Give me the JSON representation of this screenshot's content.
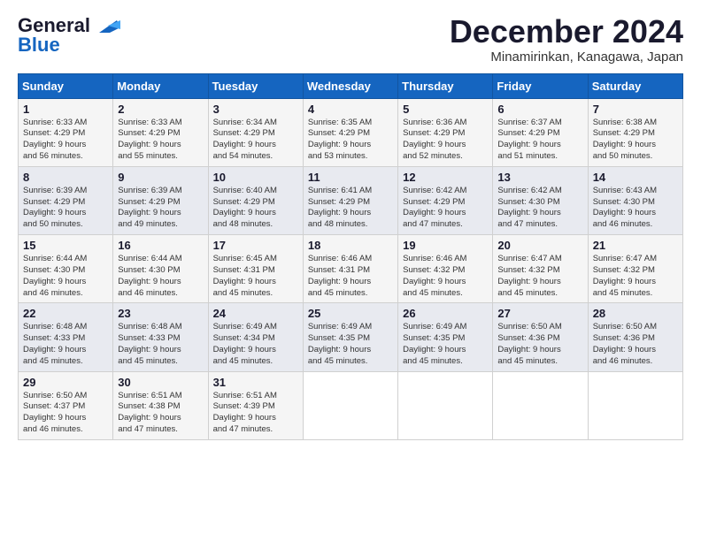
{
  "logo": {
    "line1": "General",
    "line2": "Blue"
  },
  "title": "December 2024",
  "subtitle": "Minamirinkan, Kanagawa, Japan",
  "days_of_week": [
    "Sunday",
    "Monday",
    "Tuesday",
    "Wednesday",
    "Thursday",
    "Friday",
    "Saturday"
  ],
  "weeks": [
    [
      {
        "day": "1",
        "sunrise": "6:33 AM",
        "sunset": "4:29 PM",
        "daylight": "9 hours and 56 minutes."
      },
      {
        "day": "2",
        "sunrise": "6:33 AM",
        "sunset": "4:29 PM",
        "daylight": "9 hours and 55 minutes."
      },
      {
        "day": "3",
        "sunrise": "6:34 AM",
        "sunset": "4:29 PM",
        "daylight": "9 hours and 54 minutes."
      },
      {
        "day": "4",
        "sunrise": "6:35 AM",
        "sunset": "4:29 PM",
        "daylight": "9 hours and 53 minutes."
      },
      {
        "day": "5",
        "sunrise": "6:36 AM",
        "sunset": "4:29 PM",
        "daylight": "9 hours and 52 minutes."
      },
      {
        "day": "6",
        "sunrise": "6:37 AM",
        "sunset": "4:29 PM",
        "daylight": "9 hours and 51 minutes."
      },
      {
        "day": "7",
        "sunrise": "6:38 AM",
        "sunset": "4:29 PM",
        "daylight": "9 hours and 50 minutes."
      }
    ],
    [
      {
        "day": "8",
        "sunrise": "6:39 AM",
        "sunset": "4:29 PM",
        "daylight": "9 hours and 50 minutes."
      },
      {
        "day": "9",
        "sunrise": "6:39 AM",
        "sunset": "4:29 PM",
        "daylight": "9 hours and 49 minutes."
      },
      {
        "day": "10",
        "sunrise": "6:40 AM",
        "sunset": "4:29 PM",
        "daylight": "9 hours and 48 minutes."
      },
      {
        "day": "11",
        "sunrise": "6:41 AM",
        "sunset": "4:29 PM",
        "daylight": "9 hours and 48 minutes."
      },
      {
        "day": "12",
        "sunrise": "6:42 AM",
        "sunset": "4:29 PM",
        "daylight": "9 hours and 47 minutes."
      },
      {
        "day": "13",
        "sunrise": "6:42 AM",
        "sunset": "4:30 PM",
        "daylight": "9 hours and 47 minutes."
      },
      {
        "day": "14",
        "sunrise": "6:43 AM",
        "sunset": "4:30 PM",
        "daylight": "9 hours and 46 minutes."
      }
    ],
    [
      {
        "day": "15",
        "sunrise": "6:44 AM",
        "sunset": "4:30 PM",
        "daylight": "9 hours and 46 minutes."
      },
      {
        "day": "16",
        "sunrise": "6:44 AM",
        "sunset": "4:30 PM",
        "daylight": "9 hours and 46 minutes."
      },
      {
        "day": "17",
        "sunrise": "6:45 AM",
        "sunset": "4:31 PM",
        "daylight": "9 hours and 45 minutes."
      },
      {
        "day": "18",
        "sunrise": "6:46 AM",
        "sunset": "4:31 PM",
        "daylight": "9 hours and 45 minutes."
      },
      {
        "day": "19",
        "sunrise": "6:46 AM",
        "sunset": "4:32 PM",
        "daylight": "9 hours and 45 minutes."
      },
      {
        "day": "20",
        "sunrise": "6:47 AM",
        "sunset": "4:32 PM",
        "daylight": "9 hours and 45 minutes."
      },
      {
        "day": "21",
        "sunrise": "6:47 AM",
        "sunset": "4:32 PM",
        "daylight": "9 hours and 45 minutes."
      }
    ],
    [
      {
        "day": "22",
        "sunrise": "6:48 AM",
        "sunset": "4:33 PM",
        "daylight": "9 hours and 45 minutes."
      },
      {
        "day": "23",
        "sunrise": "6:48 AM",
        "sunset": "4:33 PM",
        "daylight": "9 hours and 45 minutes."
      },
      {
        "day": "24",
        "sunrise": "6:49 AM",
        "sunset": "4:34 PM",
        "daylight": "9 hours and 45 minutes."
      },
      {
        "day": "25",
        "sunrise": "6:49 AM",
        "sunset": "4:35 PM",
        "daylight": "9 hours and 45 minutes."
      },
      {
        "day": "26",
        "sunrise": "6:49 AM",
        "sunset": "4:35 PM",
        "daylight": "9 hours and 45 minutes."
      },
      {
        "day": "27",
        "sunrise": "6:50 AM",
        "sunset": "4:36 PM",
        "daylight": "9 hours and 45 minutes."
      },
      {
        "day": "28",
        "sunrise": "6:50 AM",
        "sunset": "4:36 PM",
        "daylight": "9 hours and 46 minutes."
      }
    ],
    [
      {
        "day": "29",
        "sunrise": "6:50 AM",
        "sunset": "4:37 PM",
        "daylight": "9 hours and 46 minutes."
      },
      {
        "day": "30",
        "sunrise": "6:51 AM",
        "sunset": "4:38 PM",
        "daylight": "9 hours and 47 minutes."
      },
      {
        "day": "31",
        "sunrise": "6:51 AM",
        "sunset": "4:39 PM",
        "daylight": "9 hours and 47 minutes."
      },
      null,
      null,
      null,
      null
    ]
  ],
  "labels": {
    "sunrise": "Sunrise:",
    "sunset": "Sunset:",
    "daylight": "Daylight:"
  }
}
